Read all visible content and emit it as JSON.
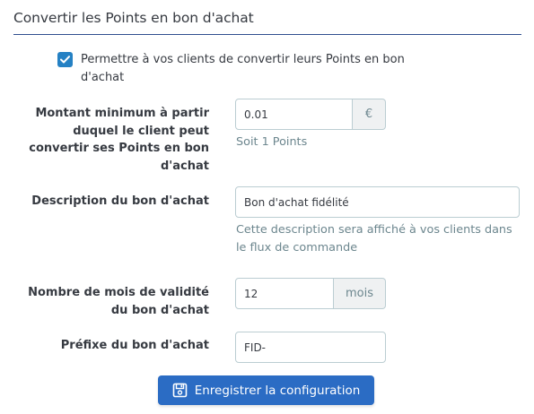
{
  "section": {
    "title": "Convertir les Points en bon d'achat"
  },
  "allow_conversion": {
    "checked": true,
    "label": "Permettre à vos clients de convertir leurs Points en bon d'achat"
  },
  "minimum_amount": {
    "label": "Montant minimum à partir duquel le client peut convertir ses Points en bon d'achat",
    "value": "0.01",
    "addon": "€",
    "help": "Soit 1 Points"
  },
  "voucher_description": {
    "label": "Description du bon d'achat",
    "value": "Bon d'achat fidélité",
    "help": "Cette description sera affiché à vos clients dans le flux de commande"
  },
  "validity_months": {
    "label": "Nombre de mois de validité du bon d'achat",
    "value": "12",
    "addon": "mois"
  },
  "voucher_prefix": {
    "label": "Préfixe du bon d'achat",
    "value": "FID-"
  },
  "save_button": {
    "icon": "save-icon",
    "label": "Enregistrer la configuration"
  },
  "colors": {
    "accent": "#2581c4",
    "button": "#2b6cc4",
    "section_rule": "#2f4f8f",
    "input_border": "#bbcdd2",
    "addon_background": "#eff1f2",
    "help_text": "#6c868e"
  }
}
